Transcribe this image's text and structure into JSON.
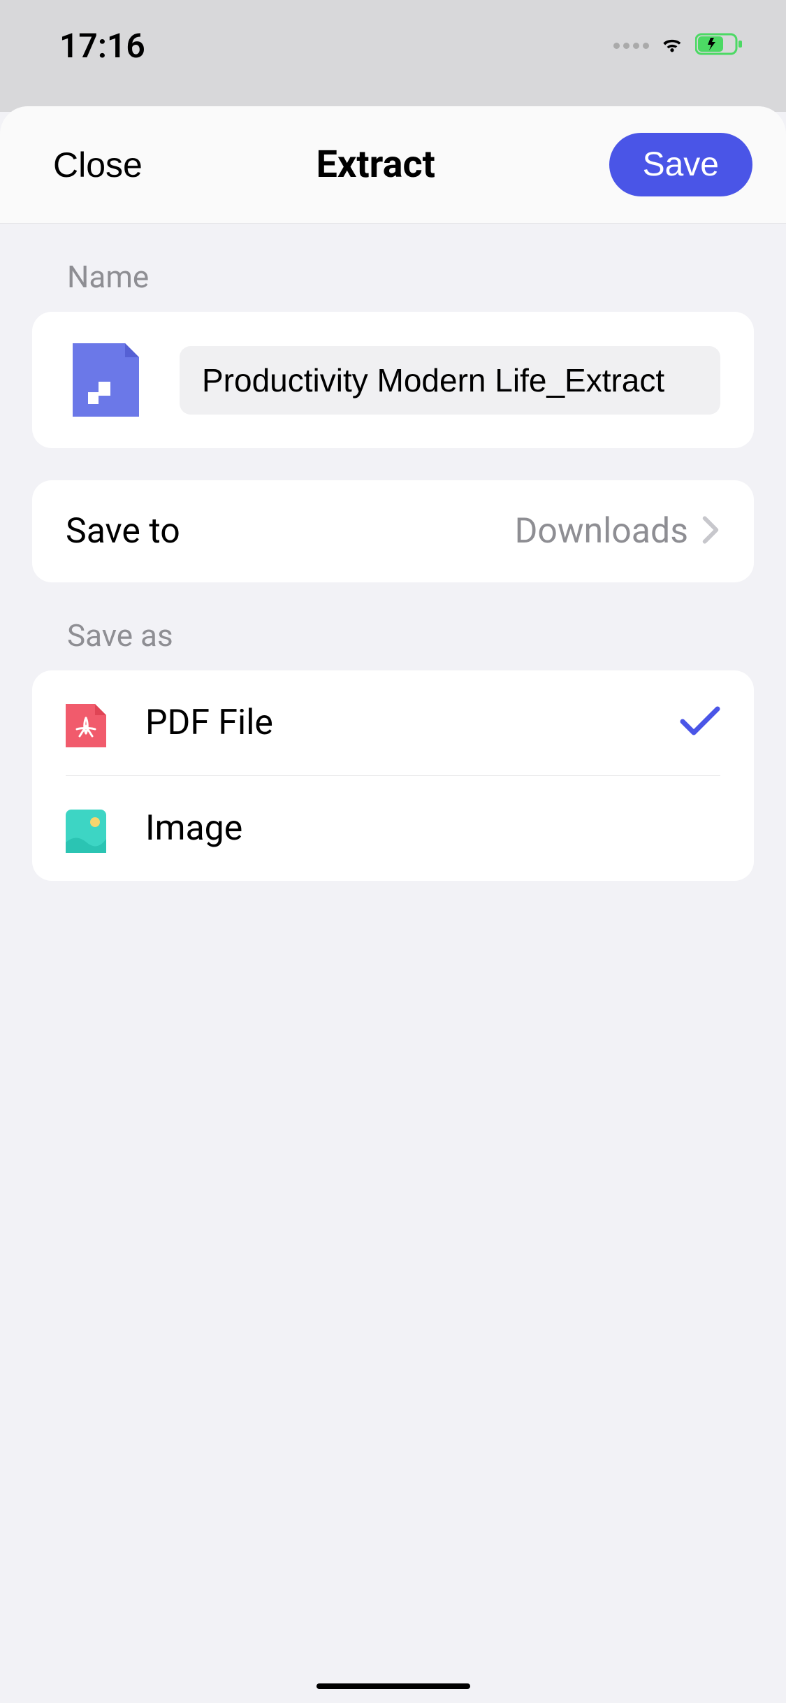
{
  "statusBar": {
    "time": "17:16"
  },
  "header": {
    "close": "Close",
    "title": "Extract",
    "save": "Save"
  },
  "nameSection": {
    "label": "Name",
    "value": "Productivity Modern Life_Extract"
  },
  "saveTo": {
    "label": "Save to",
    "value": "Downloads"
  },
  "saveAs": {
    "label": "Save as",
    "options": [
      {
        "label": "PDF File",
        "selected": true
      },
      {
        "label": "Image",
        "selected": false
      }
    ]
  }
}
